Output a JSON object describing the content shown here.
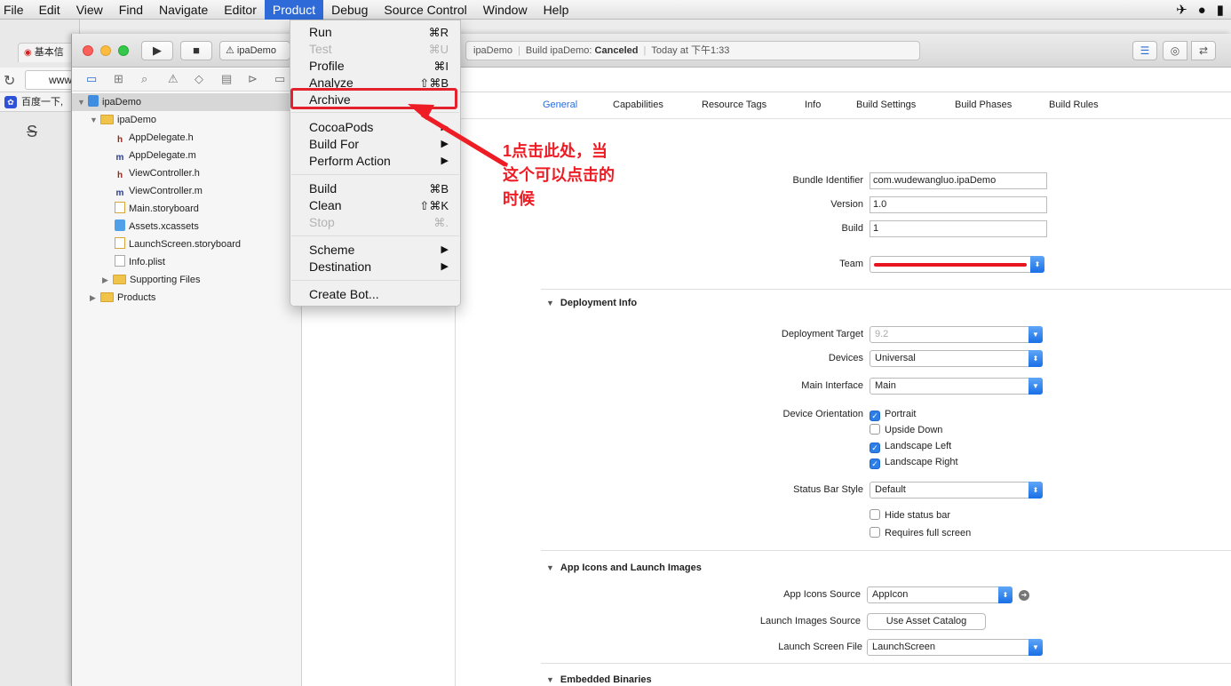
{
  "menubar": {
    "items": [
      "File",
      "Edit",
      "View",
      "Find",
      "Navigate",
      "Editor",
      "Product",
      "Debug",
      "Source Control",
      "Window",
      "Help"
    ],
    "active": "Product",
    "status_icons": [
      "bluetooth-icon",
      "qq-penguin-icon",
      "battery-icon"
    ]
  },
  "browser": {
    "tab_label": "基本信",
    "url_text": "www",
    "bookmark_text": "百度一下,"
  },
  "toolbar": {
    "scheme_label": "ipaDemo",
    "activity": {
      "project": "ipaDemo",
      "status_prefix": "Build ipaDemo:",
      "status_value": "Canceled",
      "time": "Today at 下午1:33"
    }
  },
  "navigator": {
    "project": "ipaDemo",
    "group": "ipaDemo",
    "files": [
      "AppDelegate.h",
      "AppDelegate.m",
      "ViewController.h",
      "ViewController.m",
      "Main.storyboard",
      "Assets.xcassets",
      "LaunchScreen.storyboard",
      "Info.plist"
    ],
    "supporting": "Supporting Files",
    "products": "Products"
  },
  "tabs": [
    "General",
    "Capabilities",
    "Resource Tags",
    "Info",
    "Build Settings",
    "Build Phases",
    "Build Rules"
  ],
  "identity": {
    "bundle_id_label": "Bundle Identifier",
    "bundle_id": "com.wudewangluo.ipaDemo",
    "version_label": "Version",
    "version": "1.0",
    "build_label": "Build",
    "build": "1",
    "team_label": "Team"
  },
  "deployment": {
    "title": "Deployment Info",
    "target_label": "Deployment Target",
    "target": "9.2",
    "devices_label": "Devices",
    "devices": "Universal",
    "main_interface_label": "Main Interface",
    "main_interface": "Main",
    "orientation_label": "Device Orientation",
    "orientations": [
      {
        "label": "Portrait",
        "checked": true
      },
      {
        "label": "Upside Down",
        "checked": false
      },
      {
        "label": "Landscape Left",
        "checked": true
      },
      {
        "label": "Landscape Right",
        "checked": true
      }
    ],
    "status_bar_label": "Status Bar Style",
    "status_bar": "Default",
    "hide_status_bar": "Hide status bar",
    "requires_full_screen": "Requires full screen"
  },
  "icons": {
    "title": "App Icons and Launch Images",
    "app_icons_label": "App Icons Source",
    "app_icons": "AppIcon",
    "launch_images_label": "Launch Images Source",
    "launch_images_button": "Use Asset Catalog",
    "launch_screen_label": "Launch Screen File",
    "launch_screen": "LaunchScreen"
  },
  "embedded": {
    "title": "Embedded Binaries"
  },
  "product_menu": {
    "run": "Run",
    "run_sc": "⌘R",
    "test": "Test",
    "test_sc": "⌘U",
    "profile": "Profile",
    "profile_sc": "⌘I",
    "analyze": "Analyze",
    "analyze_sc": "⇧⌘B",
    "archive": "Archive",
    "cocoapods": "CocoaPods",
    "build_for": "Build For",
    "perform_action": "Perform Action",
    "build": "Build",
    "build_sc": "⌘B",
    "clean": "Clean",
    "clean_sc": "⇧⌘K",
    "stop": "Stop",
    "stop_sc": "⌘.",
    "scheme": "Scheme",
    "destination": "Destination",
    "create_bot": "Create Bot..."
  },
  "annotation": {
    "line1": "1点击此处，当",
    "line2": "这个可以点击的",
    "line3": "时候",
    "color": "#ee1c24"
  }
}
